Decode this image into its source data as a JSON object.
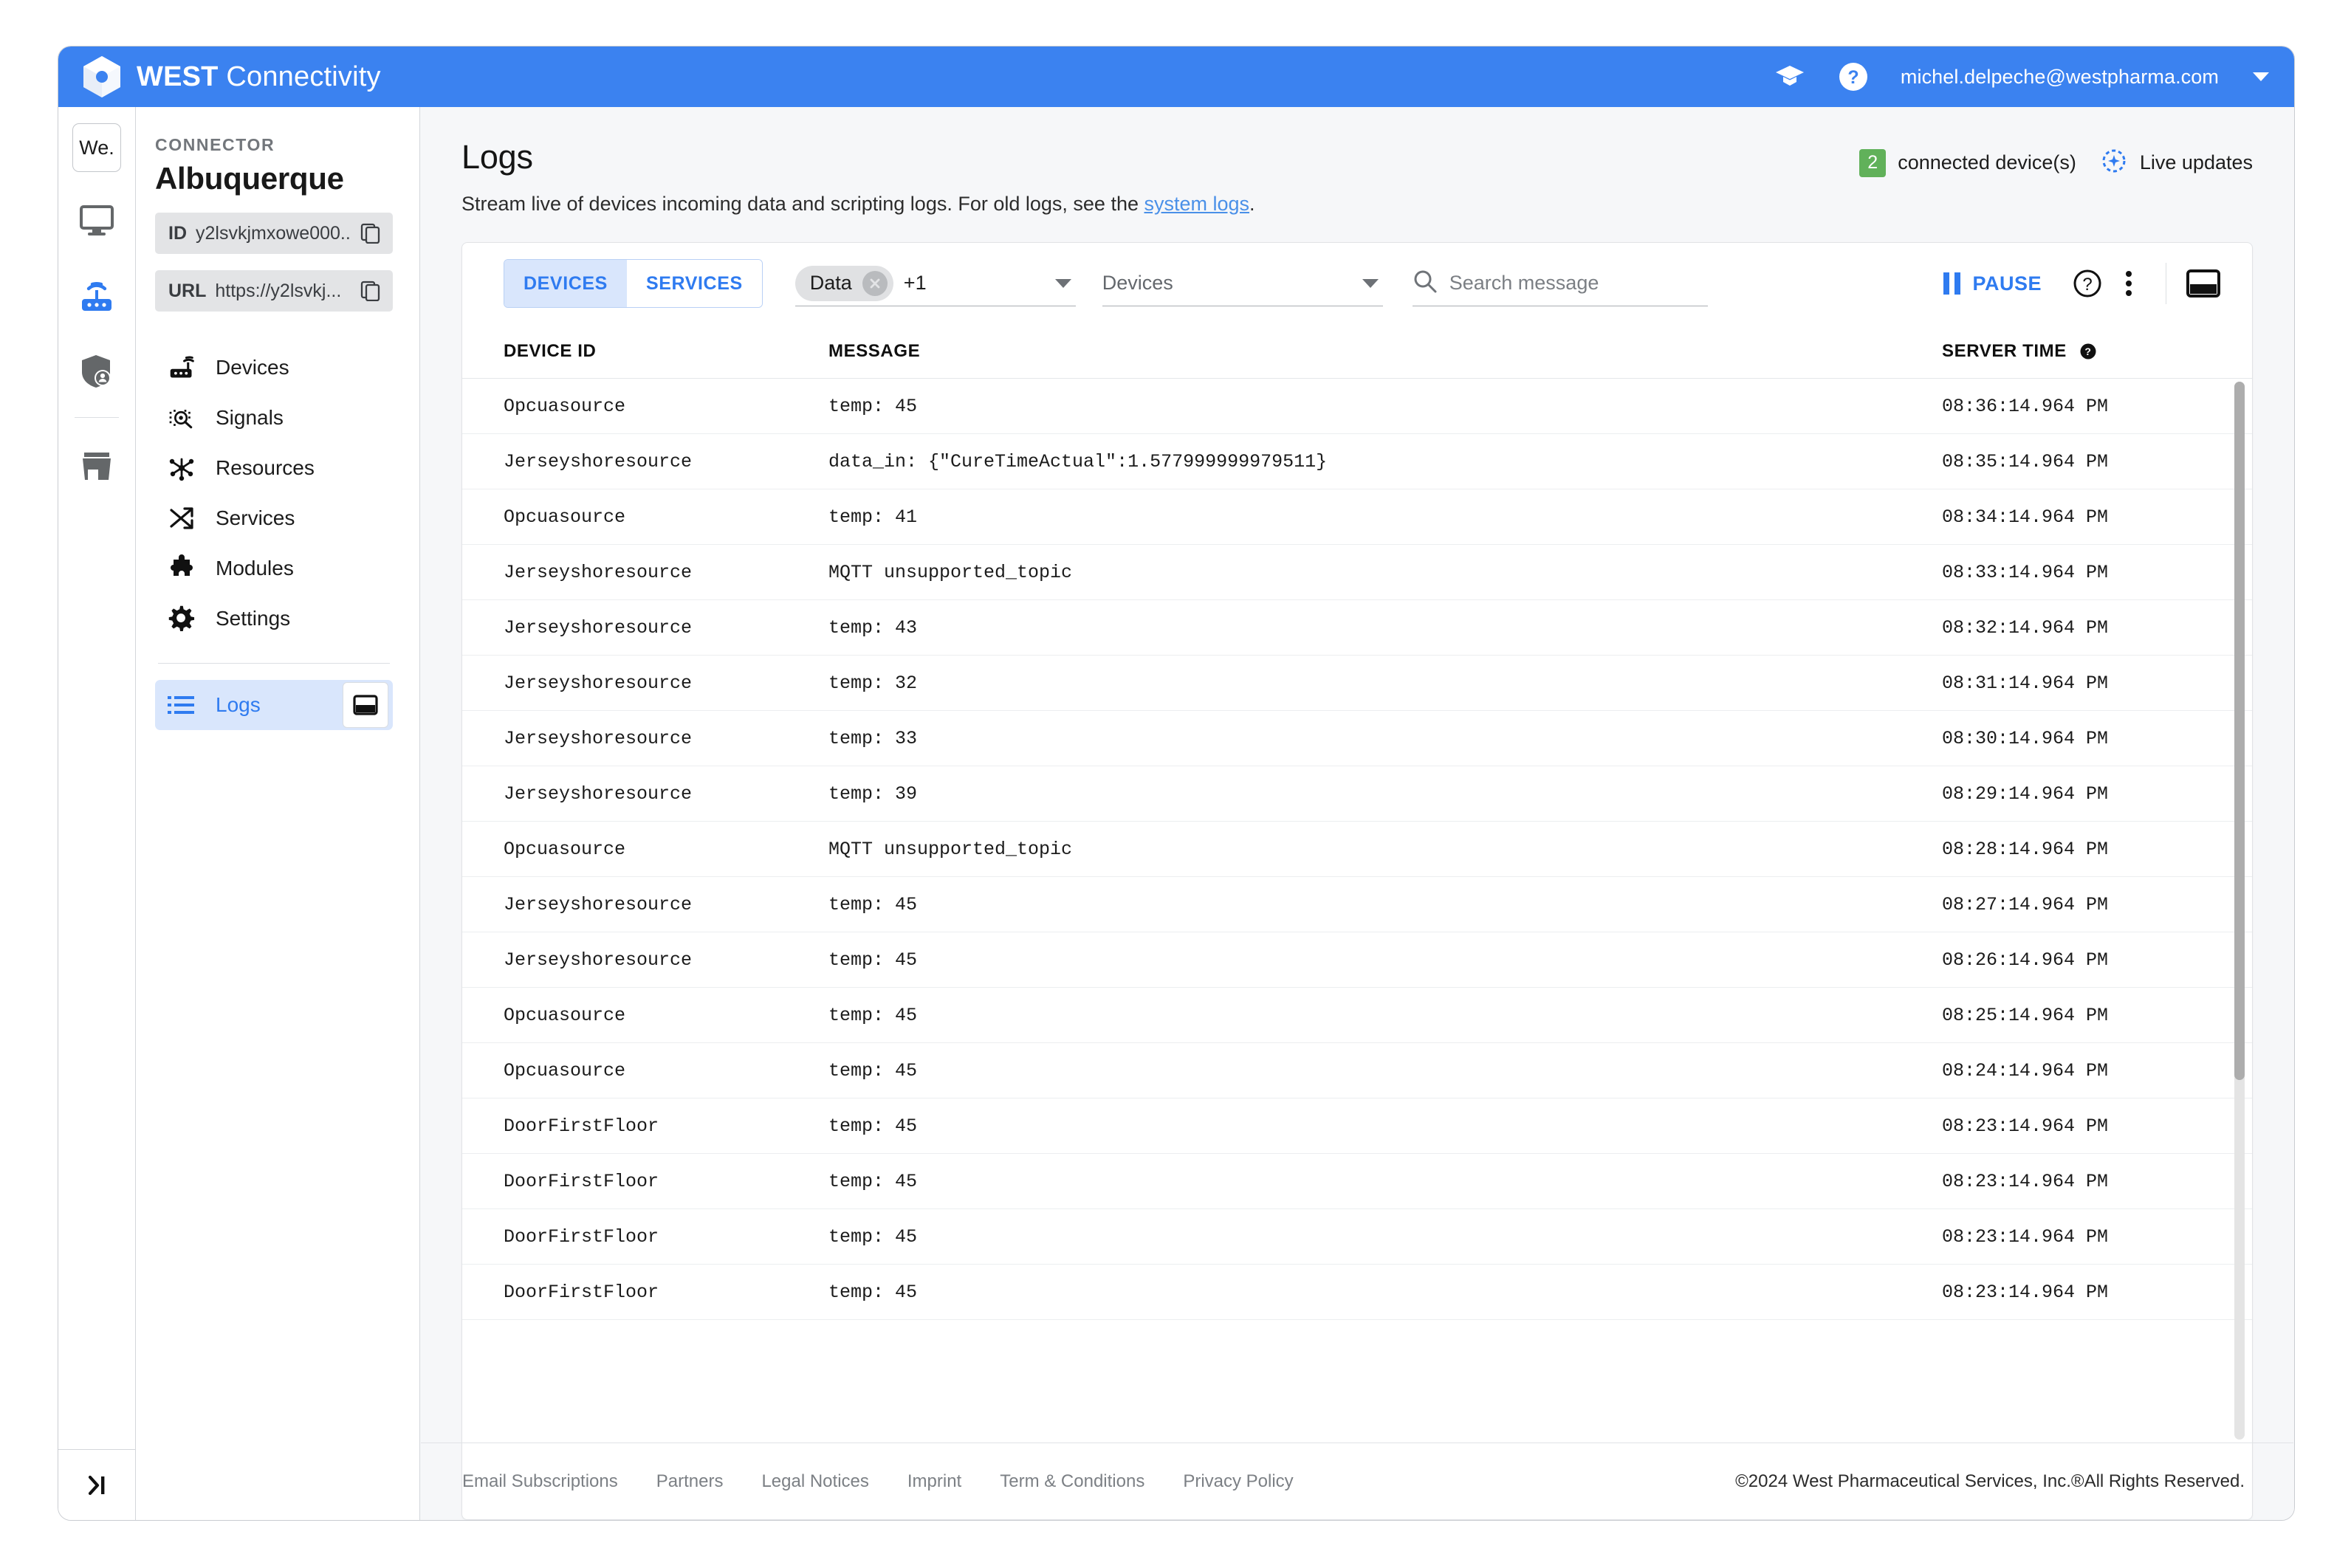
{
  "topbar": {
    "brand_bold": "WEST",
    "brand_light": "Connectivity",
    "academy_icon": "graduation-cap-icon",
    "help_icon": "help-circle-icon",
    "user_email": "michel.delpeche@westpharma.com"
  },
  "rail": {
    "tenant_badge": "We.",
    "icons": [
      "monitor-icon",
      "router-icon",
      "shield-user-icon",
      "storefront-icon"
    ],
    "collapse_icon": "collapse-panel-icon"
  },
  "connector": {
    "label": "CONNECTOR",
    "name": "Albuquerque",
    "id_key": "ID",
    "id_value": "y2lsvkjmxowe000...",
    "url_key": "URL",
    "url_value": "https://y2lsvkj...",
    "copy_icon": "copy-icon",
    "nav": [
      {
        "label": "Devices",
        "icon": "router-icon"
      },
      {
        "label": "Signals",
        "icon": "signal-scan-icon"
      },
      {
        "label": "Resources",
        "icon": "resources-hub-icon"
      },
      {
        "label": "Services",
        "icon": "shuffle-icon"
      },
      {
        "label": "Modules",
        "icon": "puzzle-icon"
      },
      {
        "label": "Settings",
        "icon": "gear-icon"
      }
    ],
    "logs_label": "Logs",
    "logs_icon": "list-icon",
    "logs_window_icon": "open-window-icon"
  },
  "page": {
    "title": "Logs",
    "subtitle_before": "Stream live of devices incoming data and scripting logs. For old logs, see the ",
    "subtitle_link": "system logs",
    "subtitle_after": ".",
    "connected_count": "2",
    "connected_text": "connected device(s)",
    "live_updates": "Live updates",
    "live_icon": "refresh-auto-icon",
    "count_color": "#61b15a"
  },
  "toolbar": {
    "tab_devices": "DEVICES",
    "tab_services": "SERVICES",
    "active_tab": "DEVICES",
    "filter_chip": "Data",
    "filter_extra": "+1",
    "chip_close_icon": "chip-close-icon",
    "devices_select_placeholder": "Devices",
    "search_placeholder": "Search message",
    "search_value": "",
    "search_icon": "search-icon",
    "pause_label": "PAUSE",
    "pause_icon": "pause-icon",
    "help_icon": "help-circle-icon",
    "more_icon": "more-vertical-icon",
    "window_icon": "open-window-icon",
    "accent_color": "#2f7bf0"
  },
  "table": {
    "columns": [
      "DEVICE ID",
      "MESSAGE",
      "SERVER TIME"
    ],
    "server_time_help_icon": "help-circle-icon",
    "rows": [
      {
        "device": "Opcuasource",
        "message": "temp: 45",
        "time": "08:36:14.964 PM"
      },
      {
        "device": "Jerseyshoresource",
        "message": "data_in: {\"CureTimeActual\":1.577999999979511}",
        "time": "08:35:14.964 PM"
      },
      {
        "device": "Opcuasource",
        "message": "temp: 41",
        "time": "08:34:14.964 PM"
      },
      {
        "device": "Jerseyshoresource",
        "message": "MQTT unsupported_topic",
        "time": "08:33:14.964 PM"
      },
      {
        "device": "Jerseyshoresource",
        "message": "temp: 43",
        "time": "08:32:14.964 PM"
      },
      {
        "device": "Jerseyshoresource",
        "message": "temp: 32",
        "time": "08:31:14.964 PM"
      },
      {
        "device": "Jerseyshoresource",
        "message": "temp: 33",
        "time": "08:30:14.964 PM"
      },
      {
        "device": "Jerseyshoresource",
        "message": "temp: 39",
        "time": "08:29:14.964 PM"
      },
      {
        "device": "Opcuasource",
        "message": "MQTT unsupported_topic",
        "time": "08:28:14.964 PM"
      },
      {
        "device": "Jerseyshoresource",
        "message": "temp: 45",
        "time": "08:27:14.964 PM"
      },
      {
        "device": "Jerseyshoresource",
        "message": "temp: 45",
        "time": "08:26:14.964 PM"
      },
      {
        "device": "Opcuasource",
        "message": "temp: 45",
        "time": "08:25:14.964 PM"
      },
      {
        "device": "Opcuasource",
        "message": "temp: 45",
        "time": "08:24:14.964 PM"
      },
      {
        "device": "DoorFirstFloor",
        "message": "temp: 45",
        "time": "08:23:14.964 PM"
      },
      {
        "device": "DoorFirstFloor",
        "message": "temp: 45",
        "time": "08:23:14.964 PM"
      },
      {
        "device": "DoorFirstFloor",
        "message": "temp: 45",
        "time": "08:23:14.964 PM"
      },
      {
        "device": "DoorFirstFloor",
        "message": "temp: 45",
        "time": "08:23:14.964 PM"
      }
    ]
  },
  "footer": {
    "links": [
      "Email Subscriptions",
      "Partners",
      "Legal Notices",
      "Imprint",
      "Term & Conditions",
      "Privacy Policy"
    ],
    "copyright": "©2024 West Pharmaceutical Services, Inc.®All Rights Reserved."
  }
}
